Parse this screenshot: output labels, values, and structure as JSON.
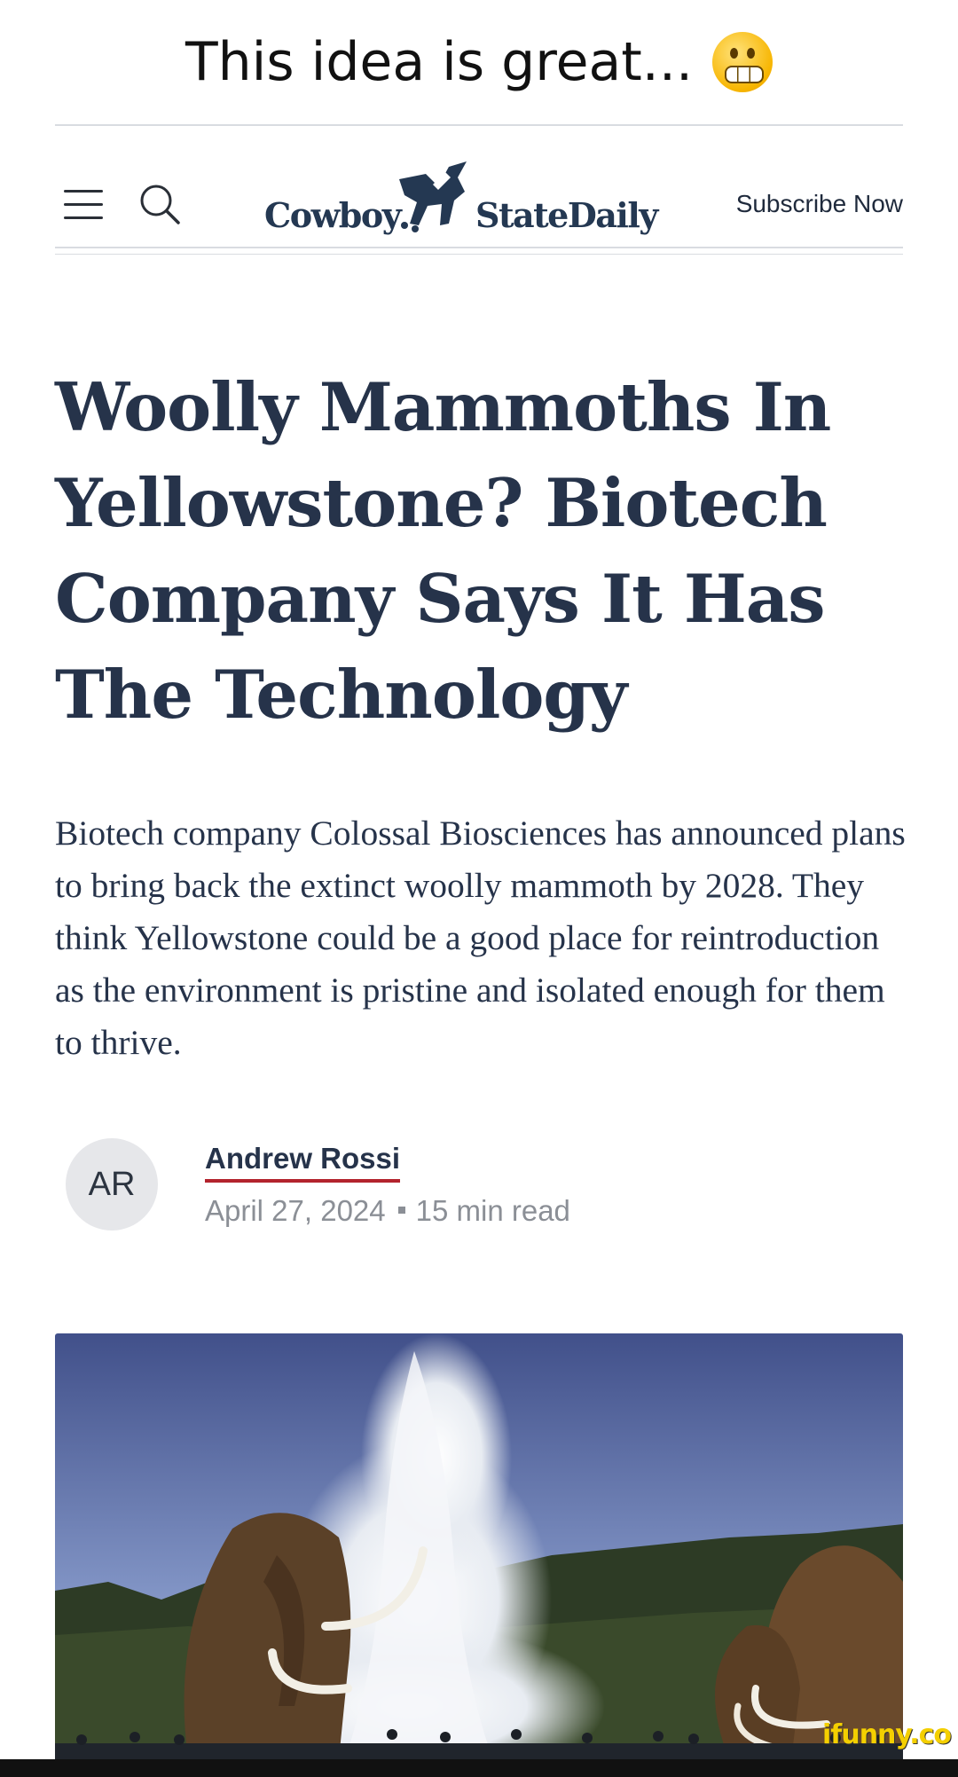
{
  "caption": {
    "text": "This idea is great...",
    "emoji": "grimacing-face-emoji"
  },
  "header": {
    "menu_icon": "hamburger-menu-icon",
    "search_icon": "search-icon",
    "logo": {
      "left": "Cowboy",
      "right": "StateDaily"
    },
    "subscribe_label": "Subscribe Now"
  },
  "article": {
    "headline": "Woolly Mammoths In Yellowstone? Biotech Company Says It Has The Technology",
    "summary": "Biotech company Colossal Biosciences has announced plans to bring back the extinct woolly mammoth by 2028. They think Yellowstone could be a good place for reintroduction as the environment is pristine and isolated enough for them to thrive.",
    "author": {
      "initials": "AR",
      "name": "Andrew Rossi"
    },
    "date": "April 27, 2024",
    "read_time": "15 min read",
    "hero_image": "woolly-mammoths-at-geyser-photo"
  },
  "watermark": "ifunny.co",
  "colors": {
    "headline": "#26334a",
    "author_underline": "#b3232d",
    "meta": "#8b8f96",
    "watermark": "#f4cf00"
  }
}
